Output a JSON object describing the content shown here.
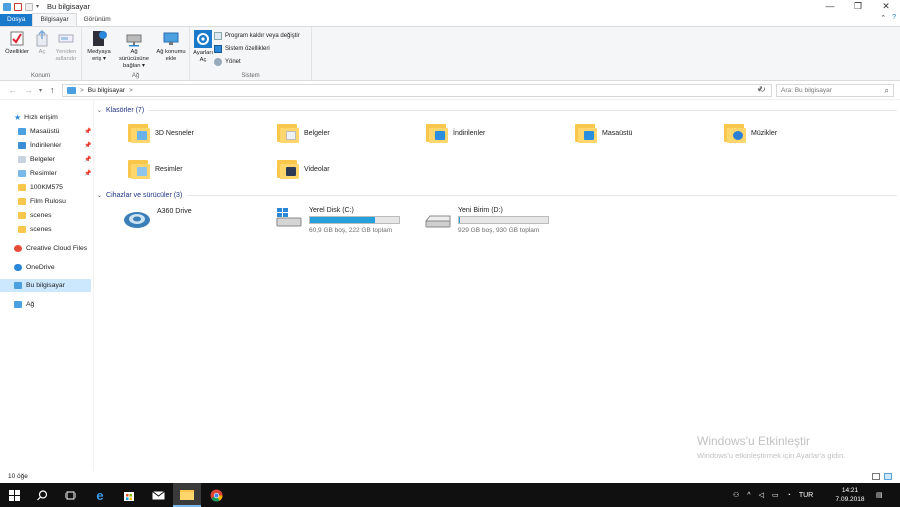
{
  "window": {
    "title": "Bu bilgisayar",
    "controls": {
      "minimize": "—",
      "maximize": "❐",
      "close": "✕"
    }
  },
  "ribbon_tabs": [
    {
      "label": "Dosya"
    },
    {
      "label": "Bilgisayar"
    },
    {
      "label": "Görünüm"
    }
  ],
  "ribbon": {
    "groups": {
      "konum": {
        "label": "Konum",
        "properties": "Özellikler",
        "open": "Aç",
        "rename_line1": "Yeniden",
        "rename_line2": "adlandır"
      },
      "ag": {
        "label": "Ağ",
        "media_line1": "Medyaya",
        "media_line2": "eriş ▾",
        "map_line1": "Ağ sürücüsüne",
        "map_line2": "bağlan ▾",
        "addloc_line1": "Ağ konumu",
        "addloc_line2": "ekle"
      },
      "sistem": {
        "label": "Sistem",
        "settings_line1": "Ayarları",
        "settings_line2": "Aç",
        "uninstall": "Program kaldır veya değiştir",
        "sysprops": "Sistem özellikleri",
        "manage": "Yönet"
      }
    }
  },
  "address": {
    "path": "Bu bilgisayar",
    "separator": ">",
    "search_placeholder": "Ara: Bu bilgisayar"
  },
  "nav": {
    "items": [
      {
        "label": "Hızlı erişim",
        "pinned": false,
        "color": "#2b88d8"
      },
      {
        "label": "Masaüstü",
        "pinned": true,
        "color": "#4ba0e0"
      },
      {
        "label": "İndirilenler",
        "pinned": true,
        "color": "#3c8fd6"
      },
      {
        "label": "Belgeler",
        "pinned": true,
        "color": "#c9d3df"
      },
      {
        "label": "Resimler",
        "pinned": true,
        "color": "#79b8e8"
      },
      {
        "label": "100KM575",
        "pinned": false,
        "color": "#f8c74c"
      },
      {
        "label": "Film Rulosu",
        "pinned": false,
        "color": "#f8c74c"
      },
      {
        "label": "scenes",
        "pinned": false,
        "color": "#f8c74c"
      },
      {
        "label": "scenes",
        "pinned": false,
        "color": "#f8c74c"
      },
      {
        "label": "Creative Cloud Files",
        "pinned": false,
        "color": "#e84a3a"
      },
      {
        "label": "OneDrive",
        "pinned": false,
        "color": "#2b88d8"
      },
      {
        "label": "Bu bilgisayar",
        "pinned": false,
        "color": "#4ba0e0",
        "selected": true
      },
      {
        "label": "Ağ",
        "pinned": false,
        "color": "#4ba0e0"
      }
    ],
    "pin_glyph": "📌"
  },
  "folders_section": {
    "title": "Klasörler (7)",
    "items": [
      {
        "label": "3D Nesneler",
        "badge": "#6ab3e8"
      },
      {
        "label": "Belgeler",
        "badge": "#eef2f6"
      },
      {
        "label": "İndirilenler",
        "badge": "#2e8ddd"
      },
      {
        "label": "Masaüstü",
        "badge": "#2a8fdf"
      },
      {
        "label": "Müzikler",
        "badge": "#2b7fd4"
      },
      {
        "label": "Resimler",
        "badge": "#8fc4ec"
      },
      {
        "label": "Videolar",
        "badge": "#2d3a55"
      }
    ]
  },
  "drives_section": {
    "title": "Cihazlar ve sürücüler (3)",
    "items": [
      {
        "name": "A360 Drive",
        "has_bar": false
      },
      {
        "name": "Yerel Disk (C:)",
        "has_bar": true,
        "used_fraction": 0.73,
        "free_text": "60,9 GB boş, 222 GB toplam"
      },
      {
        "name": "Yeni Birim (D:)",
        "has_bar": true,
        "used_fraction": 0.001,
        "free_text": "929 GB boş, 930 GB toplam"
      }
    ]
  },
  "watermark": {
    "line1": "Windows'u Etkinleştir",
    "line2": "Windows'u etkinleştirmek için Ayarlar'a gidin."
  },
  "status": {
    "item_count": "10 öğe"
  },
  "taskbar": {
    "language": "TUR",
    "time": "14:21",
    "date": "7.09.2018"
  },
  "colors": {
    "accent": "#1979ca",
    "selection": "#cce8ff",
    "progress": "#26a0da"
  }
}
